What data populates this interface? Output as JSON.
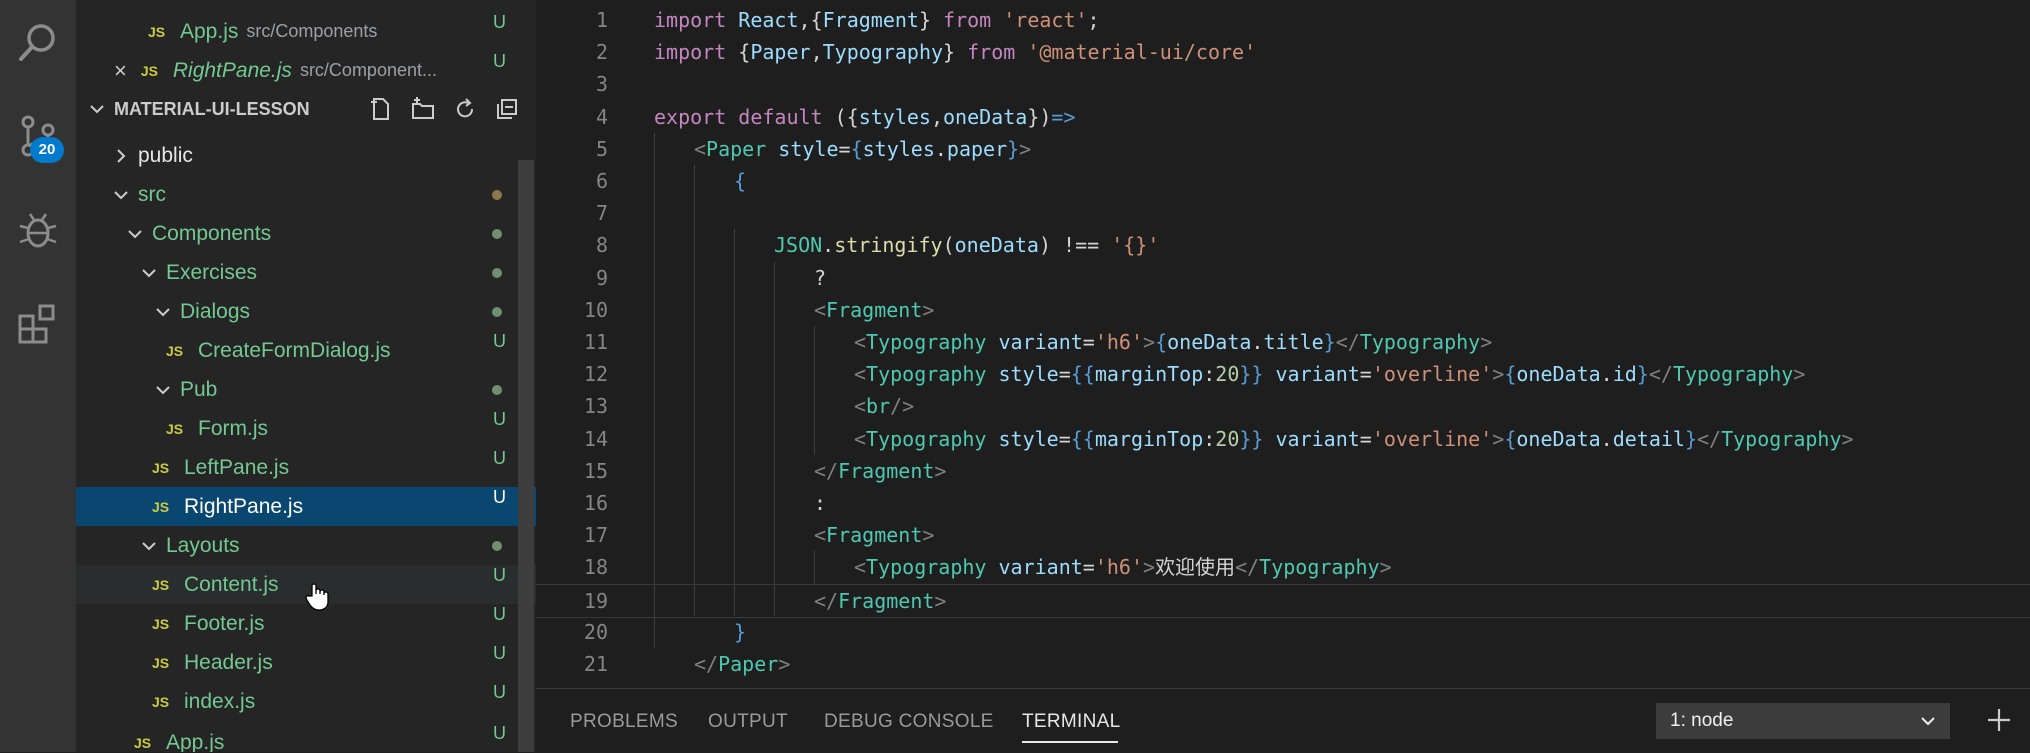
{
  "activity_bar": {
    "icons": [
      "search-icon",
      "source-control-icon",
      "debug-icon",
      "extensions-icon"
    ],
    "source_control_badge": "20"
  },
  "sidebar": {
    "open_editors": [
      {
        "name": "App.js",
        "path": "src/Components",
        "status": "U",
        "tag": "JS"
      },
      {
        "name": "RightPane.js",
        "path": "src/Component...",
        "status": "U",
        "tag": "JS",
        "close": "×"
      }
    ],
    "explorer_title": "MATERIAL-UI-LESSON",
    "tree": [
      {
        "label": "public",
        "status": ""
      },
      {
        "label": "src",
        "status": ""
      },
      {
        "label": "Components",
        "status": ""
      },
      {
        "label": "Exercises",
        "status": ""
      },
      {
        "label": "Dialogs",
        "status": ""
      },
      {
        "label": "CreateFormDialog.js",
        "status": "U",
        "tag": "JS"
      },
      {
        "label": "Pub",
        "status": ""
      },
      {
        "label": "Form.js",
        "status": "U",
        "tag": "JS"
      },
      {
        "label": "LeftPane.js",
        "status": "U",
        "tag": "JS"
      },
      {
        "label": "RightPane.js",
        "status": "U",
        "tag": "JS"
      },
      {
        "label": "Layouts",
        "status": ""
      },
      {
        "label": "Content.js",
        "status": "U",
        "tag": "JS"
      },
      {
        "label": "Footer.js",
        "status": "U",
        "tag": "JS"
      },
      {
        "label": "Header.js",
        "status": "U",
        "tag": "JS"
      },
      {
        "label": "index.js",
        "status": "U",
        "tag": "JS"
      },
      {
        "label": "App.js",
        "status": "U",
        "tag": "JS"
      }
    ]
  },
  "editor": {
    "line_numbers": [
      "1",
      "2",
      "3",
      "4",
      "5",
      "6",
      "7",
      "8",
      "9",
      "10",
      "11",
      "12",
      "13",
      "14",
      "15",
      "16",
      "17",
      "18",
      "19",
      "20",
      "21"
    ],
    "lines": [
      [
        {
          "t": "import ",
          "c": "kw"
        },
        {
          "t": "React",
          "c": "var"
        },
        {
          "t": ",{",
          "c": "punc"
        },
        {
          "t": "Fragment",
          "c": "var"
        },
        {
          "t": "} ",
          "c": "punc"
        },
        {
          "t": "from ",
          "c": "kw"
        },
        {
          "t": "'react'",
          "c": "str"
        },
        {
          "t": ";",
          "c": "punc"
        }
      ],
      [
        {
          "t": "import ",
          "c": "kw"
        },
        {
          "t": "{",
          "c": "punc"
        },
        {
          "t": "Paper",
          "c": "var"
        },
        {
          "t": ",",
          "c": "punc"
        },
        {
          "t": "Typography",
          "c": "var"
        },
        {
          "t": "} ",
          "c": "punc"
        },
        {
          "t": "from ",
          "c": "kw"
        },
        {
          "t": "'@material-ui/core'",
          "c": "str"
        }
      ],
      [],
      [
        {
          "t": "export ",
          "c": "kw"
        },
        {
          "t": "default ",
          "c": "kw"
        },
        {
          "t": "({",
          "c": "punc"
        },
        {
          "t": "styles",
          "c": "var"
        },
        {
          "t": ",",
          "c": "punc"
        },
        {
          "t": "oneData",
          "c": "var"
        },
        {
          "t": "})",
          "c": "punc"
        },
        {
          "t": "=>",
          "c": "blue"
        }
      ],
      [
        {
          "t": "<",
          "c": "ang"
        },
        {
          "t": "Paper ",
          "c": "tag"
        },
        {
          "t": "style",
          "c": "var"
        },
        {
          "t": "=",
          "c": "punc"
        },
        {
          "t": "{",
          "c": "blue"
        },
        {
          "t": "styles",
          "c": "var"
        },
        {
          "t": ".",
          "c": "punc"
        },
        {
          "t": "paper",
          "c": "var"
        },
        {
          "t": "}",
          "c": "blue"
        },
        {
          "t": ">",
          "c": "ang"
        }
      ],
      [
        {
          "t": "{",
          "c": "blue"
        }
      ],
      [],
      [
        {
          "t": "JSON",
          "c": "tag"
        },
        {
          "t": ".",
          "c": "punc"
        },
        {
          "t": "stringify",
          "c": "fn"
        },
        {
          "t": "(",
          "c": "punc"
        },
        {
          "t": "oneData",
          "c": "var"
        },
        {
          "t": ") ",
          "c": "punc"
        },
        {
          "t": "!== ",
          "c": "punc"
        },
        {
          "t": "'{}'",
          "c": "str"
        }
      ],
      [
        {
          "t": "?",
          "c": "punc"
        }
      ],
      [
        {
          "t": "<",
          "c": "ang"
        },
        {
          "t": "Fragment",
          "c": "tag"
        },
        {
          "t": ">",
          "c": "ang"
        }
      ],
      [
        {
          "t": "<",
          "c": "ang"
        },
        {
          "t": "Typography ",
          "c": "tag"
        },
        {
          "t": "variant",
          "c": "var"
        },
        {
          "t": "=",
          "c": "punc"
        },
        {
          "t": "'h6'",
          "c": "str"
        },
        {
          "t": ">",
          "c": "ang"
        },
        {
          "t": "{",
          "c": "blue"
        },
        {
          "t": "oneData",
          "c": "var"
        },
        {
          "t": ".",
          "c": "punc"
        },
        {
          "t": "title",
          "c": "var"
        },
        {
          "t": "}",
          "c": "blue"
        },
        {
          "t": "</",
          "c": "ang"
        },
        {
          "t": "Typography",
          "c": "tag"
        },
        {
          "t": ">",
          "c": "ang"
        }
      ],
      [
        {
          "t": "<",
          "c": "ang"
        },
        {
          "t": "Typography ",
          "c": "tag"
        },
        {
          "t": "style",
          "c": "var"
        },
        {
          "t": "=",
          "c": "punc"
        },
        {
          "t": "{{",
          "c": "blue"
        },
        {
          "t": "marginTop",
          "c": "var"
        },
        {
          "t": ":",
          "c": "punc"
        },
        {
          "t": "20",
          "c": "num"
        },
        {
          "t": "}} ",
          "c": "blue"
        },
        {
          "t": "variant",
          "c": "var"
        },
        {
          "t": "=",
          "c": "punc"
        },
        {
          "t": "'overline'",
          "c": "str"
        },
        {
          "t": ">",
          "c": "ang"
        },
        {
          "t": "{",
          "c": "blue"
        },
        {
          "t": "oneData",
          "c": "var"
        },
        {
          "t": ".",
          "c": "punc"
        },
        {
          "t": "id",
          "c": "var"
        },
        {
          "t": "}",
          "c": "blue"
        },
        {
          "t": "</",
          "c": "ang"
        },
        {
          "t": "Typography",
          "c": "tag"
        },
        {
          "t": ">",
          "c": "ang"
        }
      ],
      [
        {
          "t": "<",
          "c": "ang"
        },
        {
          "t": "br",
          "c": "tag"
        },
        {
          "t": "/>",
          "c": "ang"
        }
      ],
      [
        {
          "t": "<",
          "c": "ang"
        },
        {
          "t": "Typography ",
          "c": "tag"
        },
        {
          "t": "style",
          "c": "var"
        },
        {
          "t": "=",
          "c": "punc"
        },
        {
          "t": "{{",
          "c": "blue"
        },
        {
          "t": "marginTop",
          "c": "var"
        },
        {
          "t": ":",
          "c": "punc"
        },
        {
          "t": "20",
          "c": "num"
        },
        {
          "t": "}} ",
          "c": "blue"
        },
        {
          "t": "variant",
          "c": "var"
        },
        {
          "t": "=",
          "c": "punc"
        },
        {
          "t": "'overline'",
          "c": "str"
        },
        {
          "t": ">",
          "c": "ang"
        },
        {
          "t": "{",
          "c": "blue"
        },
        {
          "t": "oneData",
          "c": "var"
        },
        {
          "t": ".",
          "c": "punc"
        },
        {
          "t": "detail",
          "c": "var"
        },
        {
          "t": "}",
          "c": "blue"
        },
        {
          "t": "</",
          "c": "ang"
        },
        {
          "t": "Typography",
          "c": "tag"
        },
        {
          "t": ">",
          "c": "ang"
        }
      ],
      [
        {
          "t": "</",
          "c": "ang"
        },
        {
          "t": "Fragment",
          "c": "tag"
        },
        {
          "t": ">",
          "c": "ang"
        }
      ],
      [
        {
          "t": ":",
          "c": "punc"
        }
      ],
      [
        {
          "t": "<",
          "c": "ang"
        },
        {
          "t": "Fragment",
          "c": "tag"
        },
        {
          "t": ">",
          "c": "ang"
        }
      ],
      [
        {
          "t": "<",
          "c": "ang"
        },
        {
          "t": "Typography ",
          "c": "tag"
        },
        {
          "t": "variant",
          "c": "var"
        },
        {
          "t": "=",
          "c": "punc"
        },
        {
          "t": "'h6'",
          "c": "str"
        },
        {
          "t": ">",
          "c": "ang"
        },
        {
          "t": "欢迎使用",
          "c": "punc"
        },
        {
          "t": "</",
          "c": "ang"
        },
        {
          "t": "Typography",
          "c": "tag"
        },
        {
          "t": ">",
          "c": "ang"
        }
      ],
      [
        {
          "t": "</",
          "c": "ang"
        },
        {
          "t": "Fragment",
          "c": "tag"
        },
        {
          "t": ">",
          "c": "ang"
        }
      ],
      [
        {
          "t": "}",
          "c": "blue"
        }
      ],
      [
        {
          "t": "</",
          "c": "ang"
        },
        {
          "t": "Paper",
          "c": "tag"
        },
        {
          "t": ">",
          "c": "ang"
        }
      ]
    ]
  },
  "panel": {
    "tabs": [
      "PROBLEMS",
      "OUTPUT",
      "DEBUG CONSOLE",
      "TERMINAL"
    ],
    "active_tab": "TERMINAL",
    "terminal_selector": "1: node"
  },
  "colors": {
    "accent": "#007acc",
    "selection": "#094771",
    "untracked": "#73c991"
  }
}
